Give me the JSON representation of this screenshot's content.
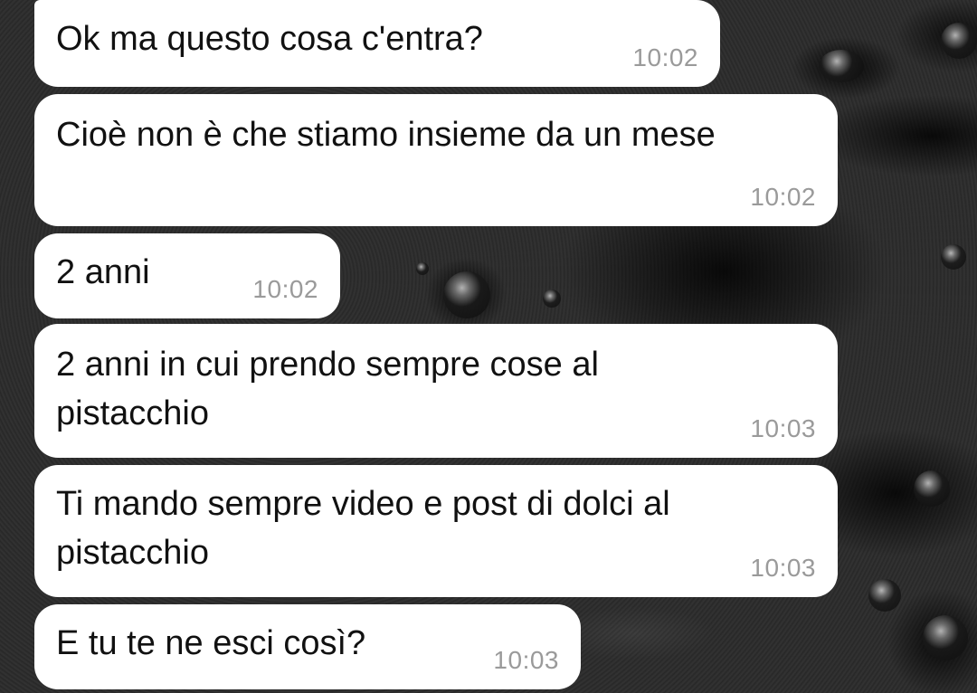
{
  "messages": [
    {
      "text": "Ok ma questo cosa c'entra?",
      "time": "10:02"
    },
    {
      "text": "Cioè non è che stiamo insieme da un mese",
      "time": "10:02"
    },
    {
      "text": "2 anni",
      "time": "10:02"
    },
    {
      "text": "2 anni in cui prendo sempre cose al\npistacchio",
      "time": "10:03"
    },
    {
      "text": "Ti mando sempre video e post di dolci al\npistacchio",
      "time": "10:03"
    },
    {
      "text": "E tu te ne esci così?",
      "time": "10:03"
    }
  ],
  "colors": {
    "bubble": "#ffffff",
    "text": "#111111",
    "time": "#9a9a9a",
    "wallpaper": "#2c2c2c"
  }
}
